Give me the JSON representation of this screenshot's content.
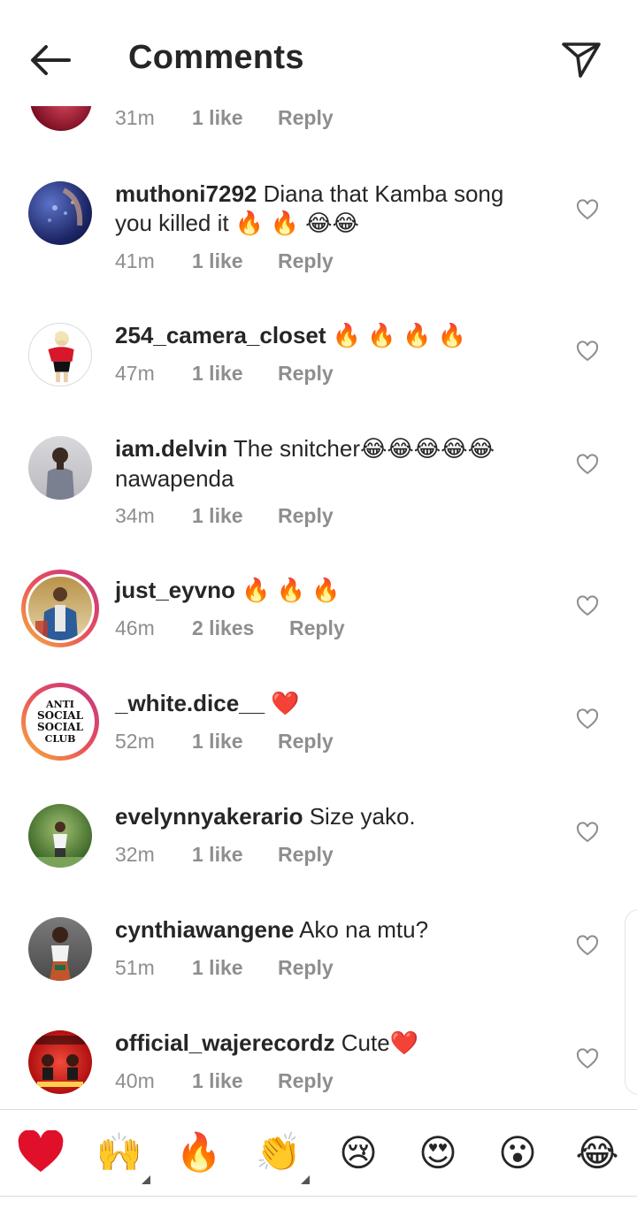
{
  "header": {
    "title": "Comments"
  },
  "partial": {
    "time": "31m",
    "likes": "1 like",
    "reply": "Reply"
  },
  "comments": [
    {
      "user": "muthoni7292",
      "text": "Diana that Kamba song you killed it",
      "time": "41m",
      "likes": "1 like",
      "reply": "Reply",
      "avatar": "purple-fabric"
    },
    {
      "user": "254_camera_closet",
      "text": "",
      "time": "47m",
      "likes": "1 like",
      "reply": "Reply",
      "avatar": "red-top-woman"
    },
    {
      "user": "iam.delvin",
      "text": "The snitcher",
      "text2": "nawapenda",
      "time": "34m",
      "likes": "1 like",
      "reply": "Reply",
      "avatar": "grey-man"
    },
    {
      "user": "just_eyvno",
      "text": "",
      "time": "46m",
      "likes": "2 likes",
      "reply": "Reply",
      "avatar": "man-jacket"
    },
    {
      "user": "_white.dice__",
      "text": "",
      "time": "52m",
      "likes": "1 like",
      "reply": "Reply",
      "avatar": "anti-social-club"
    },
    {
      "user": "evelynnyakerario",
      "text": "Size yako.",
      "time": "32m",
      "likes": "1 like",
      "reply": "Reply",
      "avatar": "woman-grass"
    },
    {
      "user": "cynthiawangene",
      "text": "Ako na mtu?",
      "time": "51m",
      "likes": "1 like",
      "reply": "Reply",
      "avatar": "woman-white-top"
    },
    {
      "user": "official_wajerecordz",
      "text": "Cute",
      "time": "40m",
      "likes": "1 like",
      "reply": "Reply",
      "avatar": "records-poster"
    }
  ],
  "anti_social_logo": [
    "ANTI",
    "SOCIAL",
    "SOCIAL",
    "CLUB"
  ],
  "emoji_bar": [
    "heart",
    "raising-hands",
    "fire",
    "clapping-hands",
    "crying-face",
    "heart-eyes",
    "surprised-face",
    "tears-of-joy"
  ],
  "colors": {
    "heart": "#e0102a",
    "text": "#262626",
    "muted": "#8e8e8e",
    "ring_start": "#f7b23b",
    "ring_end": "#c13584"
  }
}
